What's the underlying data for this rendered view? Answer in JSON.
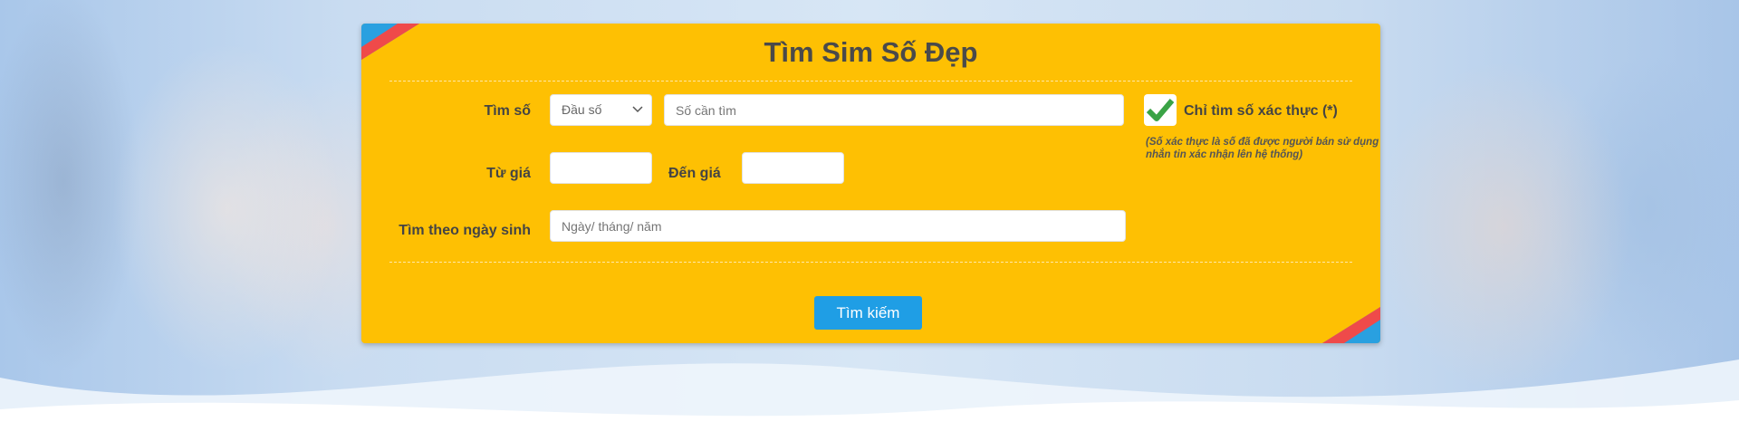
{
  "form": {
    "title": "Tìm Sim Số Đẹp",
    "search_label": "Tìm số",
    "prefix_select_value": "Đầu số",
    "number_placeholder": "Số cần tìm",
    "verified_label": "Chỉ tìm số xác thực (*)",
    "verified_checked": true,
    "verified_note": "(Số xác thực là số đã được người bán sử dụng nhắn tin xác nhận lên hệ thống)",
    "price_from_label": "Từ giá",
    "price_to_label": "Đến giá",
    "price_from_value": "",
    "price_to_value": "",
    "birthday_label": "Tìm theo ngày sinh",
    "birthday_placeholder": "Ngày/ tháng/ năm",
    "search_button": "Tìm kiếm"
  },
  "colors": {
    "panel": "#fec003",
    "button": "#1f9ee5",
    "corner_blue": "#29a0e0",
    "corner_red": "#ef4a4a",
    "check": "#3aa346"
  },
  "icons": {
    "select_caret": "chevron-down-icon",
    "checkmark": "checkmark-icon"
  }
}
